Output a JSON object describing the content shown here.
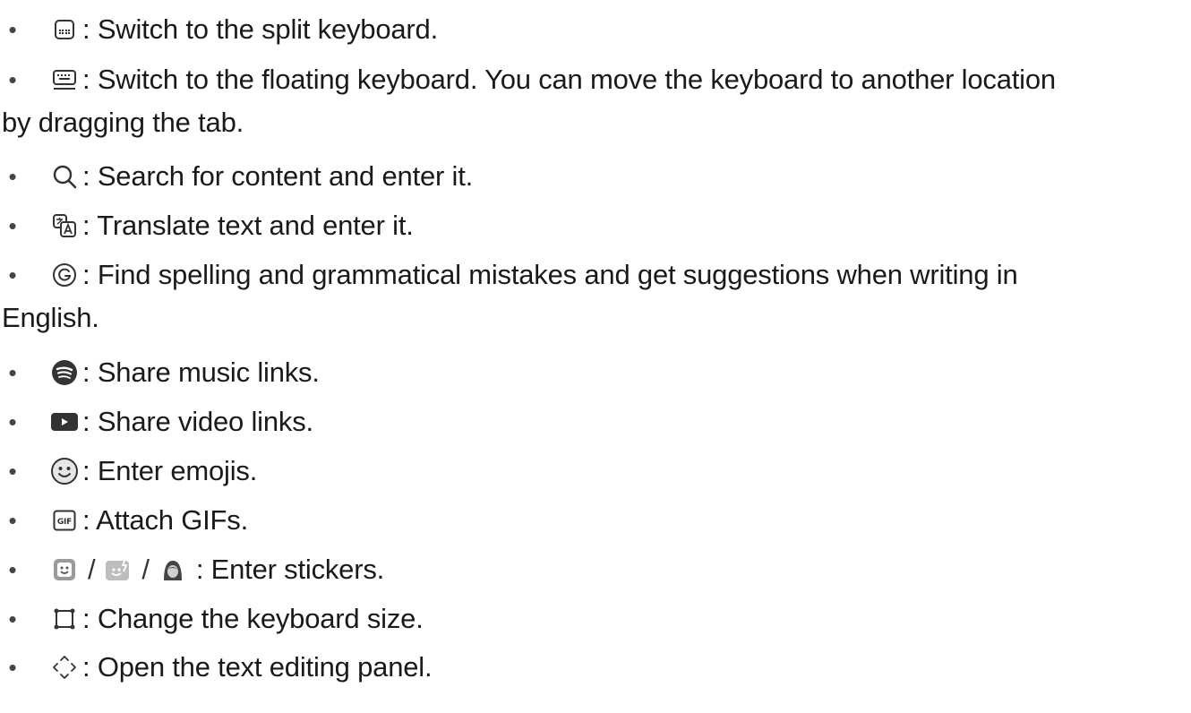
{
  "items": [
    {
      "icon": "split-keyboard-icon",
      "text": ": Switch to the split keyboard."
    },
    {
      "icon": "floating-keyboard-icon",
      "text": ": Switch to the floating keyboard. You can move the keyboard to another location",
      "text_cont": "by dragging the tab."
    },
    {
      "icon": "search-icon",
      "text": ": Search for content and enter it."
    },
    {
      "icon": "translate-icon",
      "text": ": Translate text and enter it."
    },
    {
      "icon": "grammarly-icon",
      "text": ": Find spelling and grammatical mistakes and get suggestions when writing in",
      "text_cont": "English."
    },
    {
      "icon": "spotify-icon",
      "text": ": Share music links."
    },
    {
      "icon": "youtube-icon",
      "text": ": Share video links."
    },
    {
      "icon": "emoji-icon",
      "text": ": Enter emojis."
    },
    {
      "icon": "gif-icon",
      "text": ": Attach GIFs."
    },
    {
      "icons": [
        "sticker-icon",
        "ar-emoji-sticker-icon",
        "avatar-sticker-icon"
      ],
      "separator": "/",
      "text": ": Enter stickers."
    },
    {
      "icon": "keyboard-size-icon",
      "text": ": Change the keyboard size."
    },
    {
      "icon": "text-editing-icon",
      "text": ": Open the text editing panel."
    }
  ],
  "bullet": "•",
  "colors": {
    "text": "#1a1a1a",
    "icon": "#333333",
    "sticker_gray": "#9a9a9a"
  }
}
